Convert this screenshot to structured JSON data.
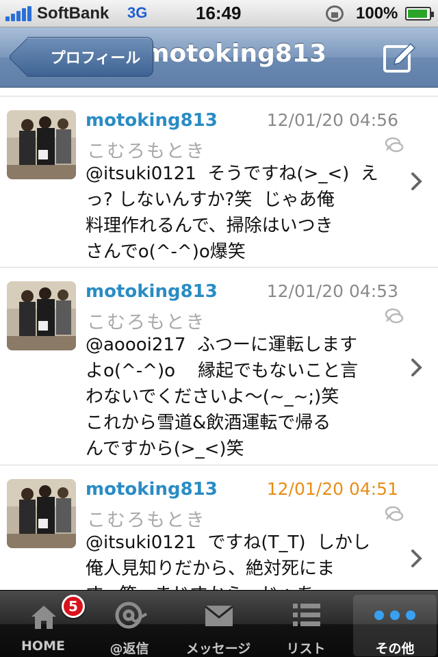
{
  "status_bar": {
    "carrier": "SoftBank",
    "network": "3G",
    "time": "16:49",
    "battery_percent": "100%"
  },
  "nav": {
    "back_label": "プロフィール",
    "title": "motoking813",
    "compose_icon": "compose-icon"
  },
  "tweets": [
    {
      "username": "motoking813",
      "display_name": "こむろもとき",
      "timestamp": "12/01/20 04:56",
      "text": "@itsuki0121  そうですね(>_<)  え\nっ? しないんすか?笑  じゃあ俺\n料理作れるんで、掃除はいつき\nさんでo(^-^)o爆笑"
    },
    {
      "username": "motoking813",
      "display_name": "こむろもとき",
      "timestamp": "12/01/20 04:53",
      "text": "@aoooi217  ふつーに運転します\nよo(^-^)o    縁起でもないこと言\nわないでくださいよ〜(~_~;)笑\nこれから雪道&飲酒運転で帰る\nんですから(>_<)笑"
    },
    {
      "username": "motoking813",
      "display_name": "こむろもとき",
      "timestamp": "12/01/20 04:51",
      "text": "@itsuki0121  ですね(T_T)  しかし\n俺人見知りだから、絶対死にま\nす。笑   まじすから〜じゃあ"
    }
  ],
  "tabbar": {
    "tabs": [
      {
        "label": "HOME",
        "icon": "home-icon",
        "badge": "5"
      },
      {
        "label": "@返信",
        "icon": "at-sign-icon"
      },
      {
        "label": "メッセージ",
        "icon": "envelope-icon"
      },
      {
        "label": "リスト",
        "icon": "list-icon"
      },
      {
        "label": "その他",
        "icon": "more-dots-icon"
      }
    ],
    "active_tab": "その他"
  },
  "colors": {
    "username": "#2a8cc4",
    "timestamp": "#8a8a8a",
    "timestamp_latest": "#e88d16",
    "nav_bar": "#6b89b1"
  }
}
